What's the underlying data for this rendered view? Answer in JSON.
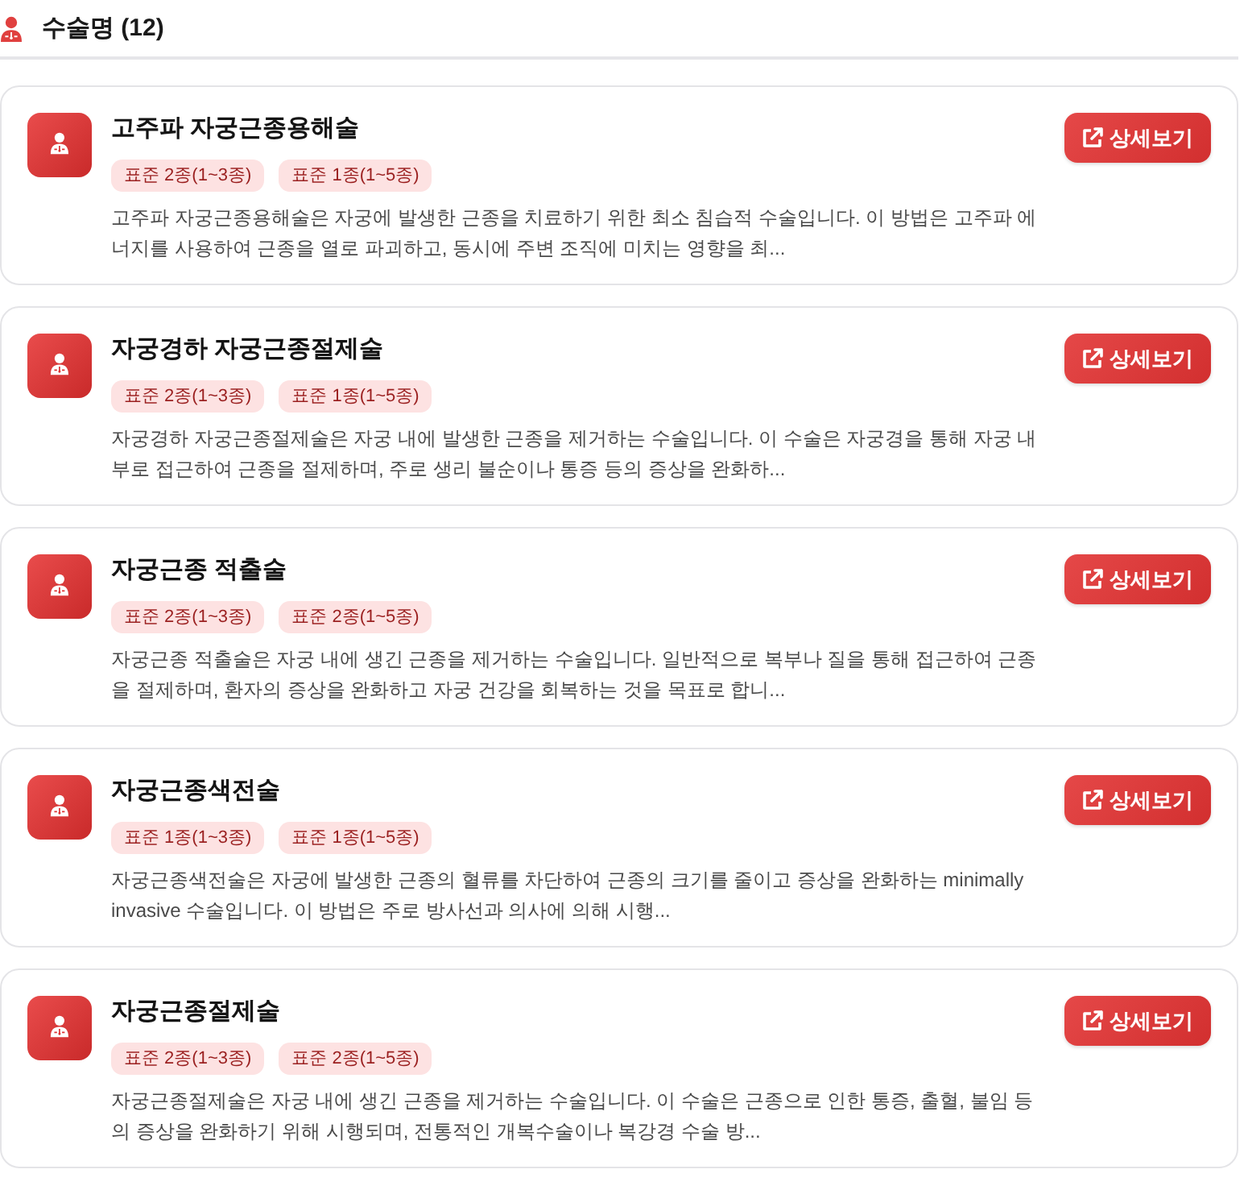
{
  "header": {
    "title": "수술명 (12)"
  },
  "procedures": [
    {
      "name": "고주파 자궁근종용해술",
      "tags": [
        "표준 2종(1~3종)",
        "표준 1종(1~5종)"
      ],
      "description": "고주파 자궁근종용해술은 자궁에 발생한 근종을 치료하기 위한 최소 침습적 수술입니다. 이 방법은 고주파 에너지를 사용하여 근종을 열로 파괴하고, 동시에 주변 조직에 미치는 영향을 최...",
      "button": "상세보기"
    },
    {
      "name": "자궁경하 자궁근종절제술",
      "tags": [
        "표준 2종(1~3종)",
        "표준 1종(1~5종)"
      ],
      "description": "자궁경하 자궁근종절제술은 자궁 내에 발생한 근종을 제거하는 수술입니다. 이 수술은 자궁경을 통해 자궁 내부로 접근하여 근종을 절제하며, 주로 생리 불순이나 통증 등의 증상을 완화하...",
      "button": "상세보기"
    },
    {
      "name": "자궁근종 적출술",
      "tags": [
        "표준 2종(1~3종)",
        "표준 2종(1~5종)"
      ],
      "description": "자궁근종 적출술은 자궁 내에 생긴 근종을 제거하는 수술입니다. 일반적으로 복부나 질을 통해 접근하여 근종을 절제하며, 환자의 증상을 완화하고 자궁 건강을 회복하는 것을 목표로 합니...",
      "button": "상세보기"
    },
    {
      "name": "자궁근종색전술",
      "tags": [
        "표준 1종(1~3종)",
        "표준 1종(1~5종)"
      ],
      "description": "자궁근종색전술은 자궁에 발생한 근종의 혈류를 차단하여 근종의 크기를 줄이고 증상을 완화하는 minimally invasive 수술입니다. 이 방법은 주로 방사선과 의사에 의해 시행...",
      "button": "상세보기"
    },
    {
      "name": "자궁근종절제술",
      "tags": [
        "표준 2종(1~3종)",
        "표준 2종(1~5종)"
      ],
      "description": "자궁근종절제술은 자궁 내에 생긴 근종을 제거하는 수술입니다. 이 수술은 근종으로 인한 통증, 출혈, 불임 등의 증상을 완화하기 위해 시행되며, 전통적인 개복수술이나 복강경 수술 방...",
      "button": "상세보기"
    }
  ]
}
